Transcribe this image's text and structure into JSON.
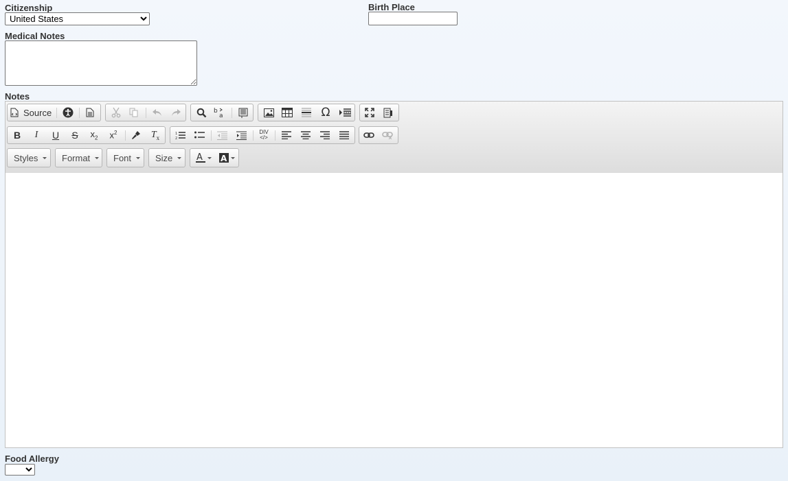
{
  "form": {
    "citizenship_label": "Citizenship",
    "citizenship_value": "United States",
    "birth_place_label": "Birth Place",
    "birth_place_value": "",
    "medical_notes_label": "Medical Notes",
    "medical_notes_value": "",
    "notes_label": "Notes",
    "food_allergy_label": "Food Allergy",
    "food_allergy_value": ""
  },
  "editor": {
    "source_label": "Source",
    "styles_label": "Styles",
    "format_label": "Format",
    "font_label": "Font",
    "size_label": "Size",
    "div_label": "DIV",
    "content": ""
  },
  "colors": {
    "background": "#edf3fa",
    "toolbar": "#e4e4e4",
    "disabled_icon": "#b3b3b3"
  }
}
